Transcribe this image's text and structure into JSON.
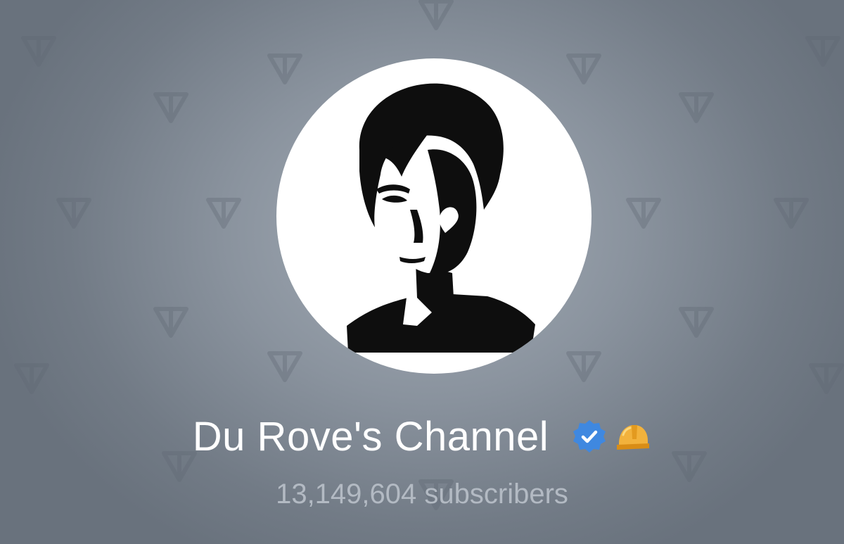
{
  "channel": {
    "name": "Du Rove's Channel",
    "subscribers": "13,149,604 subscribers",
    "verified": true,
    "emoji_status": "construction-helmet"
  },
  "background": {
    "pattern_icon": "ton-logo-icon"
  },
  "colors": {
    "background_center": "#a4adb7",
    "background_edge": "#69727d",
    "name_text": "#ffffff",
    "subscribers_text": "#b3bac3",
    "verified_badge": "#3f88e0",
    "helmet": "#f2b23c"
  },
  "icons": {
    "avatar": "silhouette-portrait",
    "verified": "verified-badge-icon",
    "status": "helmet-icon"
  }
}
